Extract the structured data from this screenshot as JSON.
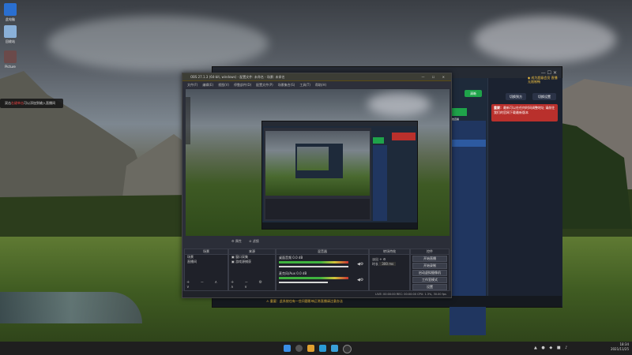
{
  "desktop": {
    "icons": [
      {
        "label": "此电脑",
        "name": "this-pc"
      },
      {
        "label": "回收站",
        "name": "recycle-bin"
      },
      {
        "label": "Picture",
        "name": "picture"
      }
    ],
    "tooltip": {
      "prefix": "双击",
      "highlight": "右键单击",
      "suffix": "可以添加到输入直播间"
    }
  },
  "backwin": {
    "title_ctrls": "— ☐ ✕",
    "promo": "成为超级会员 直播无限制畅",
    "buttons": {
      "a": "清晰",
      "b": "设置",
      "c": "切换到方",
      "d": "切换设置"
    },
    "alert": {
      "title": "重要：",
      "text": "最新可以在任何时间调整地址 请前往我们的官网下载最新版本"
    },
    "green_button": "开始直播",
    "statusbar": {
      "warn": "⚠ 重要：此系统也有一些问题影响正常直播请注意办法"
    }
  },
  "obs": {
    "title": "OBS 27.1.3 (64-bit, windows) - 配置文件: 未命名 - 场景: 未命名",
    "title_ctrls": "— ☐ ✕",
    "menu": [
      "文件(F)",
      "编辑(E)",
      "视图(V)",
      "停靠部件(D)",
      "配置文件(P)",
      "场景集合(S)",
      "工具(T)",
      "帮助(H)"
    ],
    "controls": {
      "props": "⚙ 属性",
      "filter": "⊘ 滤镜"
    },
    "docks": {
      "scenes": {
        "header": "场景",
        "items": [
          "场景",
          "直播间"
        ],
        "footer": "+ − ∧ ∨"
      },
      "sources": {
        "header": "来源",
        "items": [
          "窗口采集",
          "游戏源捕获"
        ],
        "footer": "+ − ⚙ ∧ ∨"
      },
      "mixer": {
        "header": "混音器",
        "tracks": [
          {
            "name": "桌面音频",
            "value": "0.0 dB",
            "level": 1.0
          },
          {
            "name": "麦克风/Aux",
            "value": "0.0 dB",
            "level": 0.7
          }
        ]
      },
      "transitions": {
        "header": "转场特效",
        "type": "淡出",
        "duration_label": "时长",
        "duration": "300 ms"
      },
      "controls": {
        "header": "控件",
        "buttons": [
          "开始直播",
          "开始录制",
          "启动虚拟摄像机",
          "工作室模式",
          "设置",
          "退出"
        ]
      }
    },
    "status": "LIVE: 00:00:00   REC: 00:00:00   CPU: 1.3%, 30.00 fps"
  },
  "taskbar": {
    "time": "18:34",
    "date": "2021/11/25"
  }
}
